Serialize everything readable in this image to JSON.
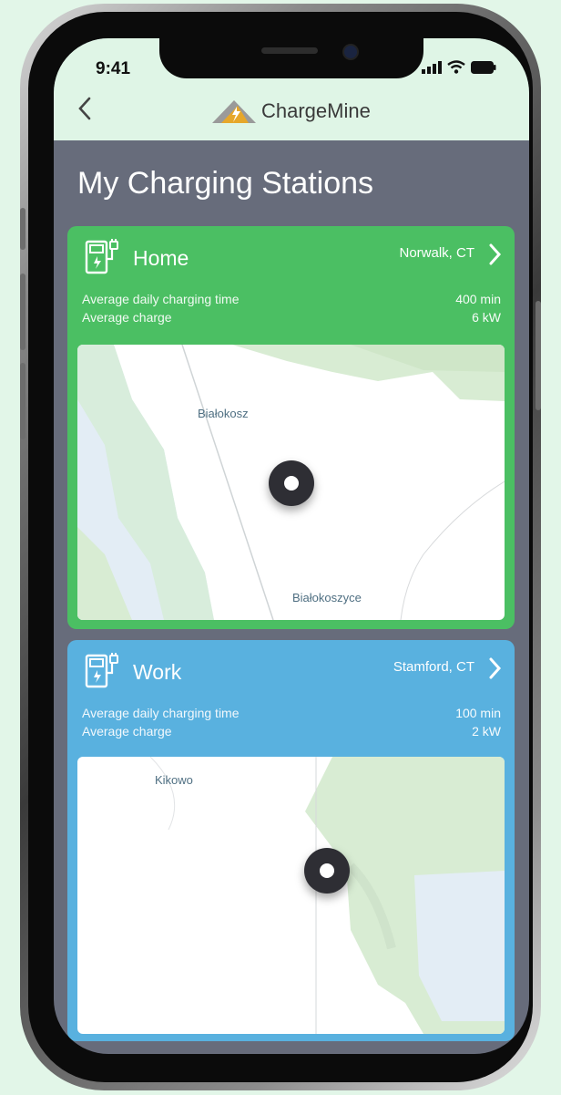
{
  "status_bar": {
    "time": "9:41"
  },
  "header": {
    "app_name": "ChargeMine"
  },
  "page": {
    "title": "My Charging Stations"
  },
  "stations": [
    {
      "name": "Home",
      "location": "Norwalk, CT",
      "stat1_label": "Average daily charging time",
      "stat1_value": "400 min",
      "stat2_label": "Average charge",
      "stat2_value": "6 kW",
      "map_labels": [
        "Białokosz",
        "Białokoszyce"
      ],
      "accent_color": "#4bbf63"
    },
    {
      "name": "Work",
      "location": "Stamford, CT",
      "stat1_label": "Average daily charging time",
      "stat1_value": "100 min",
      "stat2_label": "Average charge",
      "stat2_value": "2 kW",
      "map_labels": [
        "Kikowo"
      ],
      "accent_color": "#59b1df"
    }
  ],
  "icons": [
    "back-chevron-icon",
    "charging-station-icon",
    "chevron-right-icon",
    "signal-icon",
    "wifi-icon",
    "battery-icon",
    "map-pin-icon"
  ]
}
